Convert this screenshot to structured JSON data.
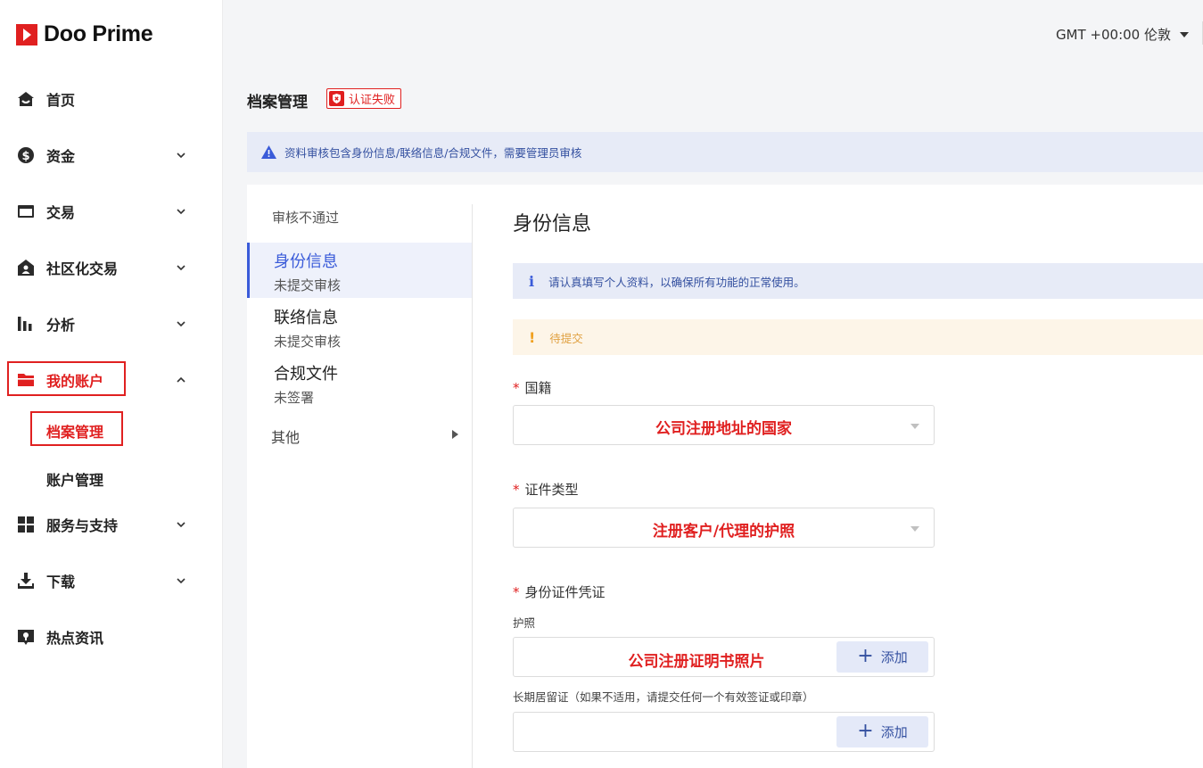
{
  "brand": {
    "name": "Doo Prime",
    "accent": "#e02020"
  },
  "header": {
    "timezone": "GMT +00:00 伦敦"
  },
  "sidebar": {
    "items": [
      {
        "label": "首页",
        "icon": "home-icon"
      },
      {
        "label": "资金",
        "icon": "dollar-icon"
      },
      {
        "label": "交易",
        "icon": "card-icon"
      },
      {
        "label": "社区化交易",
        "icon": "community-icon"
      },
      {
        "label": "分析",
        "icon": "bar-chart-icon"
      },
      {
        "label": "我的账户",
        "icon": "folder-icon"
      },
      {
        "label": "服务与支持",
        "icon": "grid-icon"
      },
      {
        "label": "下载",
        "icon": "download-icon"
      },
      {
        "label": "热点资讯",
        "icon": "news-icon"
      }
    ],
    "sub_items": [
      "档案管理",
      "账户管理"
    ]
  },
  "page": {
    "title": "档案管理",
    "status": "认证失败",
    "notice": "资料审核包含身份信息/联络信息/合规文件，需要管理员审核"
  },
  "subnav": {
    "heading": "审核不通过",
    "items": [
      {
        "title": "身份信息",
        "status": "未提交审核"
      },
      {
        "title": "联络信息",
        "status": "未提交审核"
      },
      {
        "title": "合规文件",
        "status": "未签署"
      }
    ],
    "other": "其他"
  },
  "form": {
    "section_title": "身份信息",
    "info": "请认真填写个人资料，以确保所有功能的正常使用。",
    "warning": "待提交",
    "nationality": {
      "label": "国籍",
      "value": "公司注册地址的国家"
    },
    "id_type": {
      "label": "证件类型",
      "value": "注册客户/代理的护照"
    },
    "id_proof": {
      "label": "身份证件凭证",
      "passport_label": "护照",
      "passport_value": "公司注册证明书照片",
      "residence_label": "长期居留证（如果不适用，请提交任何一个有效签证或印章）",
      "residence_value": ""
    },
    "add_label": "添加"
  }
}
